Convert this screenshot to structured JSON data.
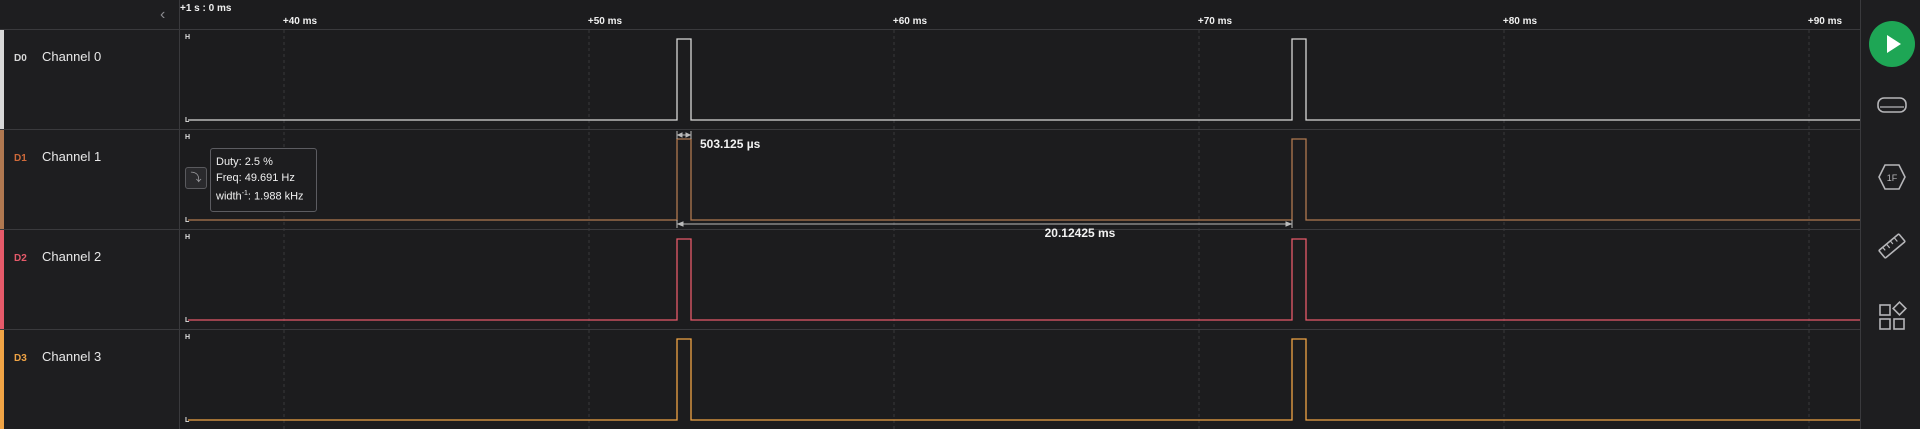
{
  "ruler": {
    "origin": "+1 s : 0 ms",
    "ticks": [
      "+40 ms",
      "+50 ms",
      "+60 ms",
      "+70 ms",
      "+80 ms",
      "+90 ms"
    ]
  },
  "channels": [
    {
      "tag": "D0",
      "name": "Channel 0",
      "color": "#d8d8d8"
    },
    {
      "tag": "D1",
      "name": "Channel 1",
      "color": "#b07850"
    },
    {
      "tag": "D2",
      "name": "Channel 2",
      "color": "#e65a6a"
    },
    {
      "tag": "D3",
      "name": "Channel 3",
      "color": "#f0a445"
    }
  ],
  "levels": {
    "high": "H",
    "low": "L"
  },
  "measurements": {
    "pulse_width": "503.125 µs",
    "period": "20.12425 ms",
    "duty": "Duty: 2.5 %",
    "freq": "Freq: 49.691 Hz",
    "width_inv_prefix": "width",
    "width_inv_sup": "-1",
    "width_inv_value": ": 1.988 kHz"
  },
  "sidebar": {
    "play": "play-icon",
    "analyzers": "analyzers-icon",
    "protocol_search": "protocol-search-icon",
    "measurements": "ruler-icon",
    "extensions": "extensions-icon"
  },
  "colors": {
    "accent_green": "#1ea655",
    "background": "#1c1c1e",
    "grid": "#3a3a3d"
  }
}
